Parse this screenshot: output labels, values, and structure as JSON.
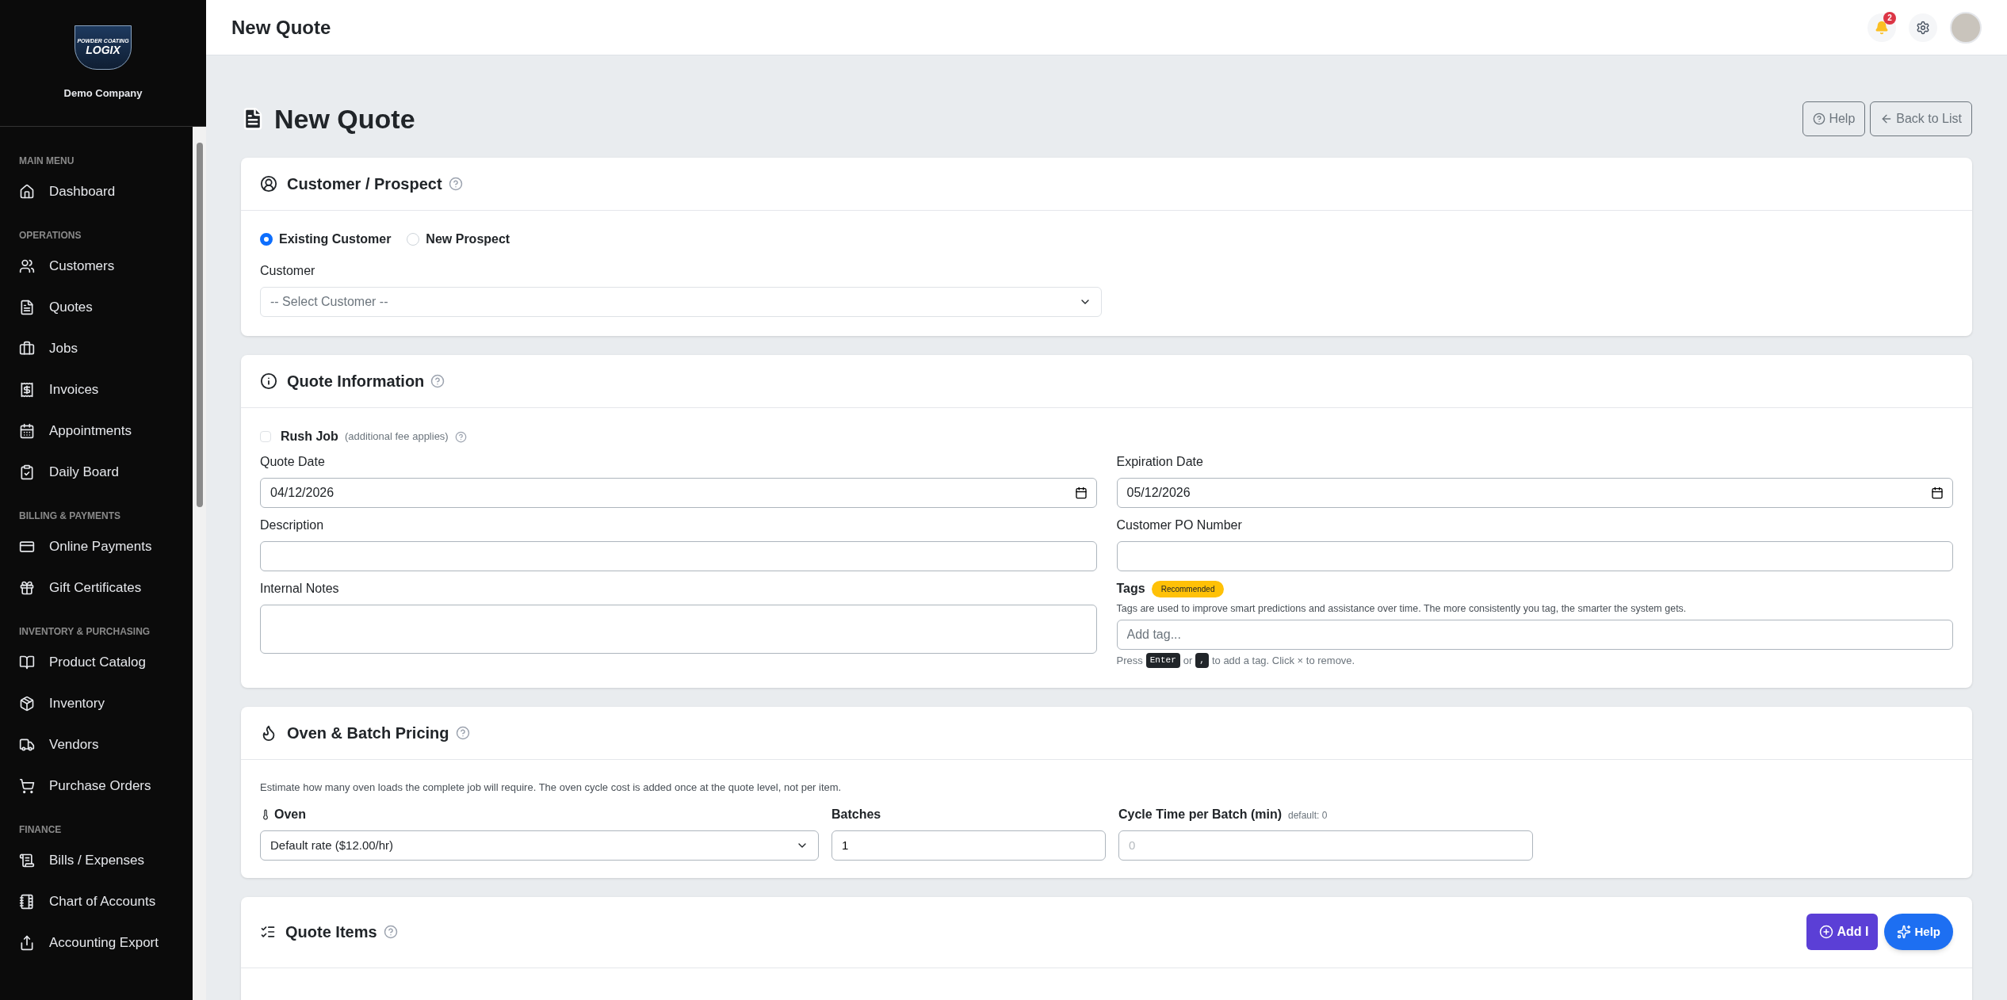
{
  "sidebar": {
    "logo_lines": [
      "POWDER COATING",
      "LOGIX"
    ],
    "company": "Demo Company",
    "sections": [
      {
        "title": "MAIN MENU",
        "items": [
          "Dashboard"
        ]
      },
      {
        "title": "OPERATIONS",
        "items": [
          "Customers",
          "Quotes",
          "Jobs",
          "Invoices",
          "Appointments",
          "Daily Board"
        ]
      },
      {
        "title": "BILLING & PAYMENTS",
        "items": [
          "Online Payments",
          "Gift Certificates"
        ]
      },
      {
        "title": "INVENTORY & PURCHASING",
        "items": [
          "Product Catalog",
          "Inventory",
          "Vendors",
          "Purchase Orders"
        ]
      },
      {
        "title": "FINANCE",
        "items": [
          "Bills / Expenses",
          "Chart of Accounts",
          "Accounting Export"
        ]
      }
    ]
  },
  "header": {
    "title": "New Quote",
    "notification_count": "2"
  },
  "page": {
    "title": "New Quote",
    "buttons": [
      "Help",
      "Back to List"
    ]
  },
  "customer_card": {
    "title": "Customer / Prospect",
    "options": [
      {
        "label": "Existing Customer",
        "selected": true
      },
      {
        "label": "New Prospect",
        "selected": false
      }
    ],
    "field_label": "Customer",
    "select_placeholder": "-- Select Customer --"
  },
  "quote_card": {
    "title": "Quote Information",
    "rush": {
      "label": "Rush Job",
      "note": "(additional fee applies)",
      "checked": false
    },
    "fields": [
      {
        "label": "Quote Date",
        "value": "04/12/2026",
        "kind": "date"
      },
      {
        "label": "Expiration Date",
        "value": "05/12/2026",
        "kind": "date"
      },
      {
        "label": "Description",
        "kind": "text"
      },
      {
        "label": "Customer PO Number",
        "kind": "text"
      }
    ],
    "notes_label": "Internal Notes",
    "tags": {
      "label": "Tags",
      "badge": "Recommended",
      "hint": "Tags are used to improve smart predictions and assistance over time. The more consistently you tag, the smarter the system gets.",
      "placeholder": "Add tag...",
      "help": [
        {
          "kind": "text",
          "text": "Press"
        },
        {
          "kind": "key",
          "text": "Enter"
        },
        {
          "kind": "text",
          "text": "or"
        },
        {
          "kind": "key",
          "text": ","
        },
        {
          "kind": "text",
          "text": "to add a tag. Click × to remove."
        }
      ]
    }
  },
  "oven_card": {
    "title": "Oven & Batch Pricing",
    "description": "Estimate how many oven loads the complete job will require. The oven cycle cost is added once at the quote level, not per item.",
    "oven": {
      "label": "Oven",
      "value": "Default rate ($12.00/hr)"
    },
    "batches": {
      "label": "Batches",
      "value": "1"
    },
    "cycle": {
      "label": "Cycle Time per Batch (min)",
      "note": "default: 0",
      "placeholder": "0"
    }
  },
  "items_card": {
    "title": "Quote Items",
    "add_button": "Add I"
  },
  "floating_help": "Help"
}
